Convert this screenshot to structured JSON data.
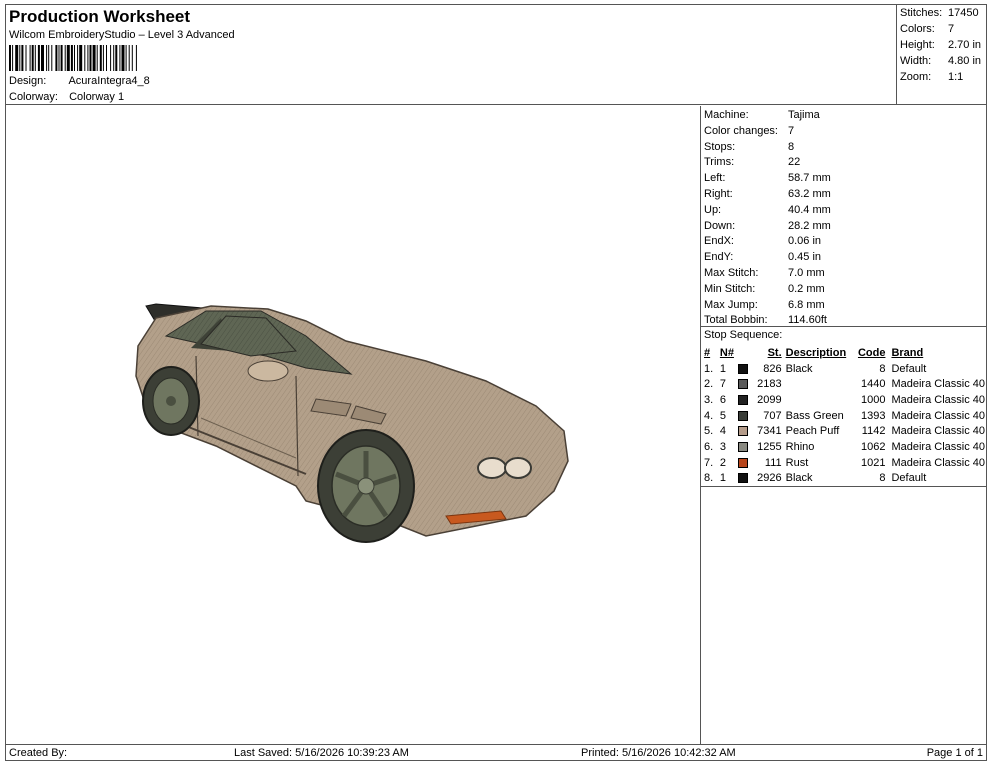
{
  "header": {
    "title": "Production Worksheet",
    "subtitle": "Wilcom EmbroideryStudio – Level 3 Advanced",
    "design_label": "Design:",
    "design_value": "AcuraIntegra4_8",
    "colorway_label": "Colorway:",
    "colorway_value": "Colorway 1"
  },
  "stats": [
    {
      "label": "Stitches:",
      "value": "17450"
    },
    {
      "label": "Colors:",
      "value": "7"
    },
    {
      "label": "Height:",
      "value": "2.70 in"
    },
    {
      "label": "Width:",
      "value": "4.80 in"
    },
    {
      "label": "Zoom:",
      "value": "1:1"
    }
  ],
  "machine": [
    {
      "label": "Machine:",
      "value": "Tajima"
    },
    {
      "label": "Color changes:",
      "value": "7"
    },
    {
      "label": "Stops:",
      "value": "8"
    },
    {
      "label": "Trims:",
      "value": "22"
    },
    {
      "label": "Left:",
      "value": "58.7 mm"
    },
    {
      "label": "Right:",
      "value": "63.2 mm"
    },
    {
      "label": "Up:",
      "value": "40.4 mm"
    },
    {
      "label": "Down:",
      "value": "28.2 mm"
    },
    {
      "label": "EndX:",
      "value": "0.06 in"
    },
    {
      "label": "EndY:",
      "value": "0.45 in"
    },
    {
      "label": "Max Stitch:",
      "value": "7.0 mm"
    },
    {
      "label": "Min Stitch:",
      "value": "0.2 mm"
    },
    {
      "label": "Max Jump:",
      "value": "6.8 mm"
    },
    {
      "label": "Total Bobbin:",
      "value": "114.60ft"
    }
  ],
  "stop_sequence": {
    "title": "Stop Sequence:",
    "headers": {
      "idx": "#",
      "n": "N#",
      "st": "St.",
      "desc": "Description",
      "code": "Code",
      "brand": "Brand"
    },
    "rows": [
      {
        "idx": "1.",
        "n": "1",
        "color": "#111111",
        "st": "826",
        "desc": "Black",
        "code": "8",
        "brand": "Default"
      },
      {
        "idx": "2.",
        "n": "7",
        "color": "#5a5a5a",
        "st": "2183",
        "desc": "",
        "code": "1440",
        "brand": "Madeira Classic 40"
      },
      {
        "idx": "3.",
        "n": "6",
        "color": "#222222",
        "st": "2099",
        "desc": "",
        "code": "1000",
        "brand": "Madeira Classic 40"
      },
      {
        "idx": "4.",
        "n": "5",
        "color": "#3a3d38",
        "st": "707",
        "desc": "Bass Green",
        "code": "1393",
        "brand": "Madeira Classic 40"
      },
      {
        "idx": "5.",
        "n": "4",
        "color": "#b59c8a",
        "st": "7341",
        "desc": "Peach Puff",
        "code": "1142",
        "brand": "Madeira Classic 40"
      },
      {
        "idx": "6.",
        "n": "3",
        "color": "#8a8a82",
        "st": "1255",
        "desc": "Rhino",
        "code": "1062",
        "brand": "Madeira Classic 40"
      },
      {
        "idx": "7.",
        "n": "2",
        "color": "#b8461c",
        "st": "111",
        "desc": "Rust",
        "code": "1021",
        "brand": "Madeira Classic 40"
      },
      {
        "idx": "8.",
        "n": "1",
        "color": "#111111",
        "st": "2926",
        "desc": "Black",
        "code": "8",
        "brand": "Default"
      }
    ]
  },
  "footer": {
    "created_by": "Created By:",
    "last_saved": "Last Saved: 5/16/2026 10:39:23 AM",
    "printed": "Printed: 5/16/2026 10:42:32 AM",
    "page": "Page 1 of 1"
  },
  "colors": {
    "car_body": "#b3a08a",
    "car_shadow": "#8d7a66",
    "window": "#5f6654",
    "wheel": "#6f7660",
    "tire": "#3c3f36",
    "rust": "#c8591f"
  }
}
